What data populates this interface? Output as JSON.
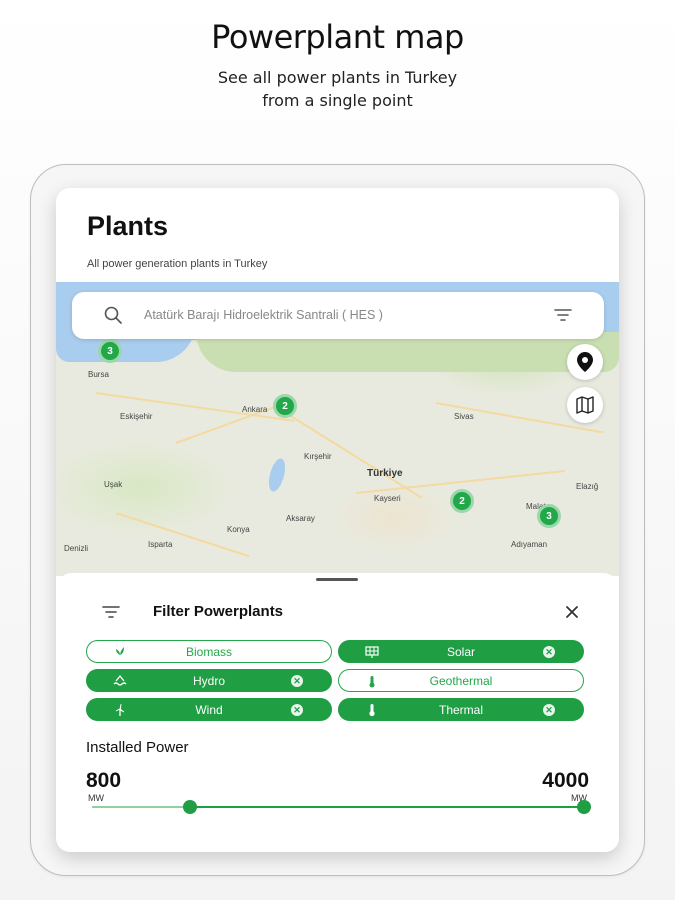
{
  "promo": {
    "title": "Powerplant map",
    "subtitle_line1": "See all power plants in Turkey",
    "subtitle_line2": "from a single point"
  },
  "app": {
    "title": "Plants",
    "subtitle": "All power generation plants in Turkey"
  },
  "search": {
    "placeholder": "Atatürk Barajı Hidroelektrik Santrali ( HES )"
  },
  "map": {
    "labels": [
      "Türkiye",
      "Ankara",
      "Kayseri",
      "Eskişehir",
      "Konya",
      "Aksaray",
      "Denizli",
      "Adıyaman",
      "Malatya",
      "Bursa",
      "Isparta",
      "Sivas",
      "Elazığ",
      "Kırşehir",
      "Uşak"
    ],
    "clusters": [
      "3",
      "2",
      "2",
      "3"
    ]
  },
  "filter": {
    "title": "Filter Powerplants",
    "chips": [
      {
        "label": "Biomass",
        "selected": false,
        "icon": "leaf-icon"
      },
      {
        "label": "Solar",
        "selected": true,
        "icon": "solar-panel-icon"
      },
      {
        "label": "Hydro",
        "selected": true,
        "icon": "water-wave-icon"
      },
      {
        "label": "Geothermal",
        "selected": false,
        "icon": "geothermal-icon"
      },
      {
        "label": "Wind",
        "selected": true,
        "icon": "wind-turbine-icon"
      },
      {
        "label": "Thermal",
        "selected": true,
        "icon": "thermometer-icon"
      }
    ],
    "chip_remove": "✕"
  },
  "power": {
    "title": "Installed Power",
    "min": "800",
    "max": "4000",
    "unit": "MW",
    "slider_min_fraction": 0.2,
    "slider_max_fraction": 1.0
  },
  "colors": {
    "accent": "#1f9e44",
    "sea": "#a9cdee",
    "map_land": "#e9eadf"
  }
}
